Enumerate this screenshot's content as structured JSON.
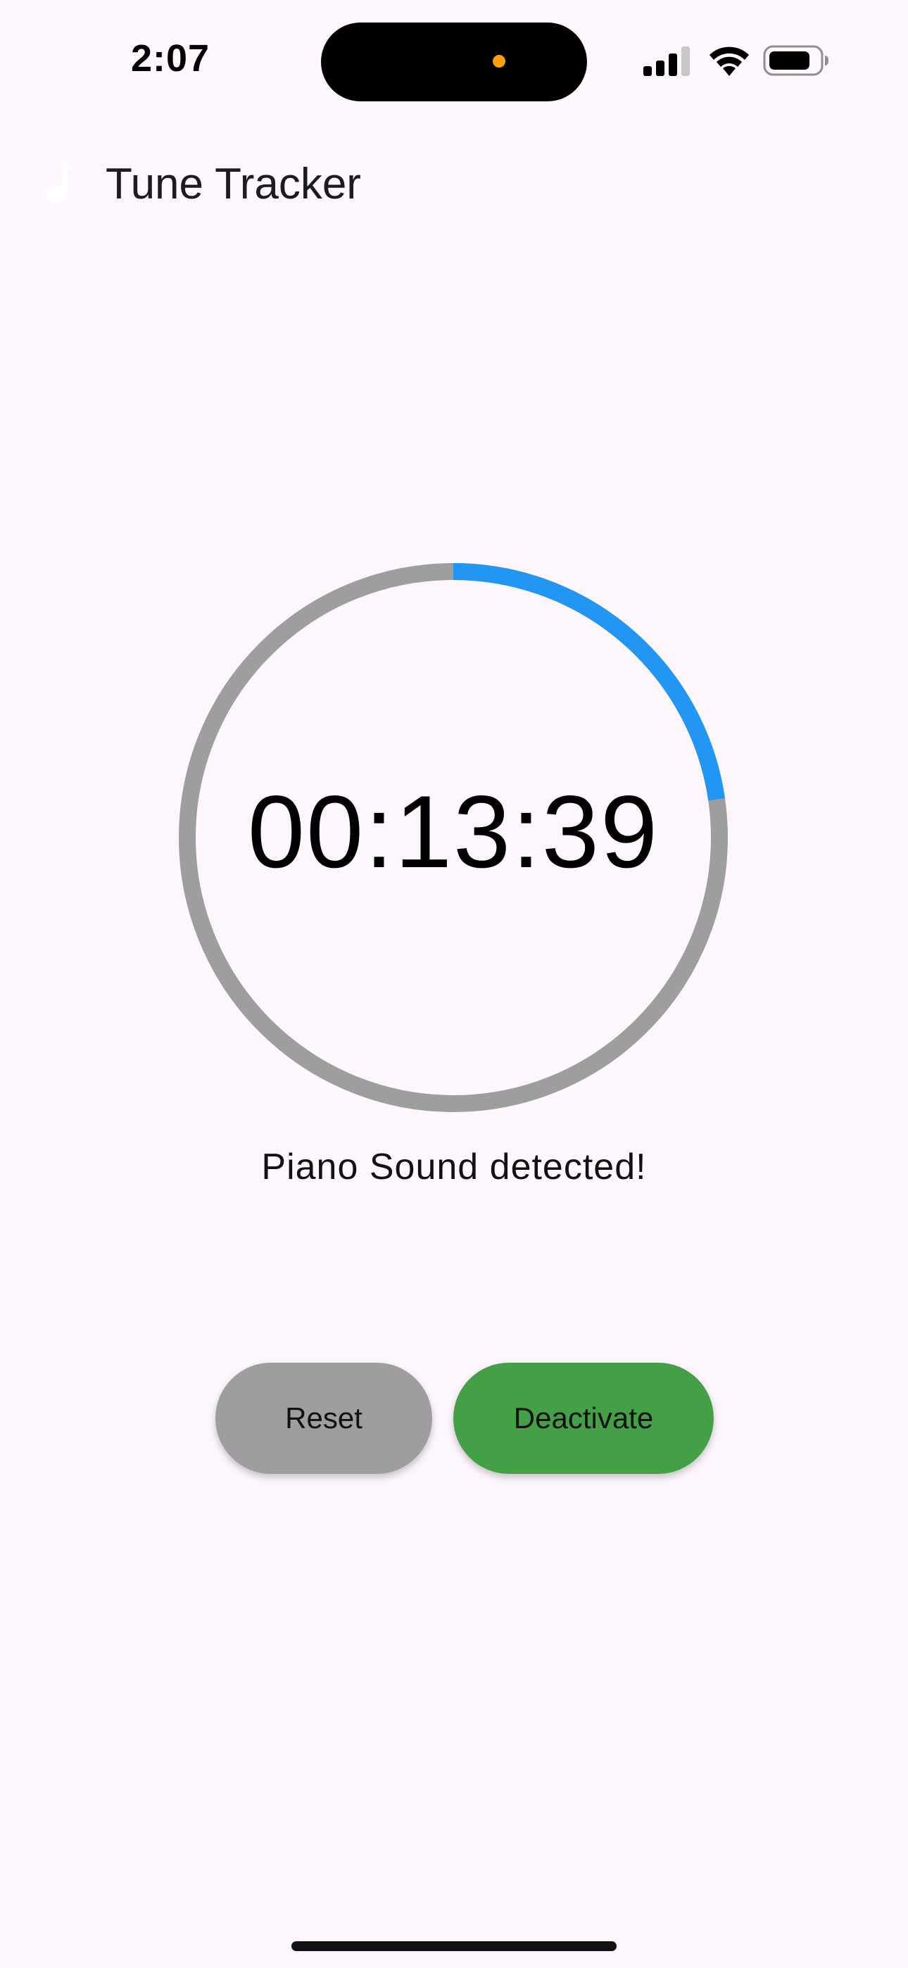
{
  "status_bar": {
    "time": "2:07",
    "camera_dot_color": "#ff9f0a",
    "icons": [
      "cellular-signal-icon",
      "wifi-icon",
      "battery-icon"
    ]
  },
  "app_bar": {
    "icon": "music-note-icon",
    "title": "Tune Tracker"
  },
  "timer": {
    "display": "00:13:39",
    "progress_fraction": 0.227,
    "progress_color": "#2196f3",
    "track_color": "#9e9e9e"
  },
  "status_message": "Piano Sound detected!",
  "buttons": {
    "reset_label": "Reset",
    "reset_color": "#9e9e9e",
    "deactivate_label": "Deactivate",
    "deactivate_color": "#43a047"
  }
}
